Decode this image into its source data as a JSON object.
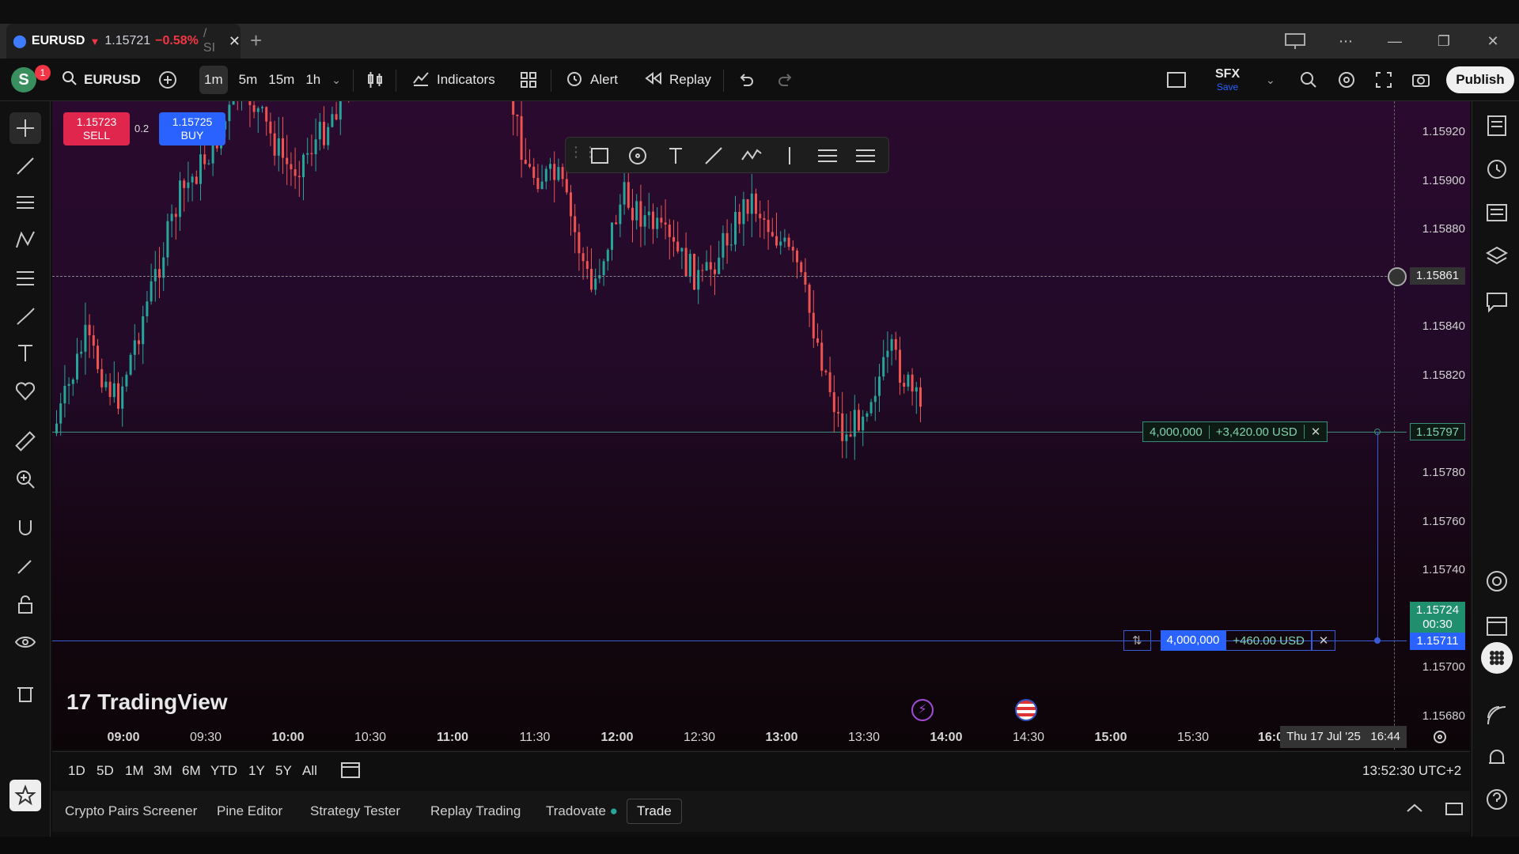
{
  "window": {
    "tab_symbol": "EURUSD",
    "tab_arrow": "▼",
    "tab_price": "1.15721",
    "tab_change": "−0.58%",
    "tab_sep": "/ SI",
    "new_tab": "+",
    "controls": [
      "⋯",
      "—",
      "❐",
      "✕"
    ]
  },
  "toolbar": {
    "avatar_letter": "S",
    "notif_count": "1",
    "symbol": "EURUSD",
    "timeframes": [
      "1m",
      "5m",
      "15m",
      "1h"
    ],
    "active_timeframe": "1m",
    "indicators_label": "Indicators",
    "alert_label": "Alert",
    "replay_label": "Replay",
    "layout_name": "SFX",
    "layout_save": "Save",
    "publish_label": "Publish"
  },
  "trade_buttons": {
    "sell_price": "1.15723",
    "sell_label": "SELL",
    "spread": "0.2",
    "buy_price": "1.15725",
    "buy_label": "BUY"
  },
  "price_axis": [
    "1.15920",
    "1.15900",
    "1.15880",
    "1.15840",
    "1.15820",
    "1.15780",
    "1.15760",
    "1.15740",
    "1.15700",
    "1.15680"
  ],
  "crosshair_price": "1.15861",
  "positions": [
    {
      "qty": "4,000,000",
      "pnl": "+3,420.00 USD",
      "close": "✕",
      "price": "1.15797"
    },
    {
      "qty": "4,000,000",
      "pnl": "+460.00 USD",
      "close": "✕",
      "price": "1.15711",
      "reverse": "⇅"
    }
  ],
  "last_price": {
    "price": "1.15724",
    "countdown": "00:30"
  },
  "time_axis": [
    "09:00",
    "09:30",
    "10:00",
    "10:30",
    "11:00",
    "11:30",
    "12:00",
    "12:30",
    "13:00",
    "13:30",
    "14:00",
    "14:30",
    "15:00",
    "15:30",
    "16:0"
  ],
  "crosshair_time": "Thu 17 Jul '25   16:44",
  "logo_text": "TradingView",
  "ranges": [
    "1D",
    "5D",
    "1M",
    "3M",
    "6M",
    "YTD",
    "1Y",
    "5Y",
    "All"
  ],
  "clock": "13:52:30 UTC+2",
  "panels": [
    "Crypto Pairs Screener",
    "Pine Editor",
    "Strategy Tester",
    "Replay Trading",
    "Tradovate",
    "Trade"
  ],
  "colors": {
    "up": "#26a69a",
    "down": "#ef5350",
    "sell": "#e0264c",
    "buy": "#2962ff",
    "position_line_green": "#3a8f7a",
    "position_line_blue": "#3a5bd9"
  }
}
